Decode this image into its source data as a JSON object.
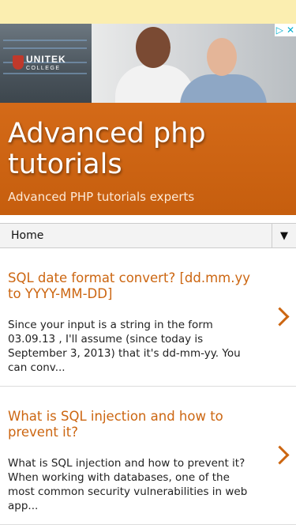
{
  "ad": {
    "logo_brand": "UNITEK",
    "logo_sub": "COLLEGE",
    "ad_choices_icon": "play-triangle-icon",
    "close_icon": "close-icon",
    "close_glyph": "✕",
    "adchoice_glyph": "▷"
  },
  "header": {
    "title": "Advanced php tutorials",
    "tagline": "Advanced PHP tutorials experts"
  },
  "nav": {
    "home_label": "Home",
    "toggle_glyph": "▼"
  },
  "posts": [
    {
      "title": "SQL date format convert? [dd.mm.yy to YYYY-MM-DD]",
      "snippet": "Since your input is a string in the form 03.09.13 , I'll assume (since today is September 3, 2013) that it's dd-mm-yy. You can conv..."
    },
    {
      "title": "What is SQL injection and how to prevent it?",
      "snippet": "What is SQL injection and how to prevent it? When working with databases, one of the most common security vulnerabilities in web app..."
    }
  ],
  "colors": {
    "accent": "#cc6611",
    "banner": "#fbeeb0"
  }
}
